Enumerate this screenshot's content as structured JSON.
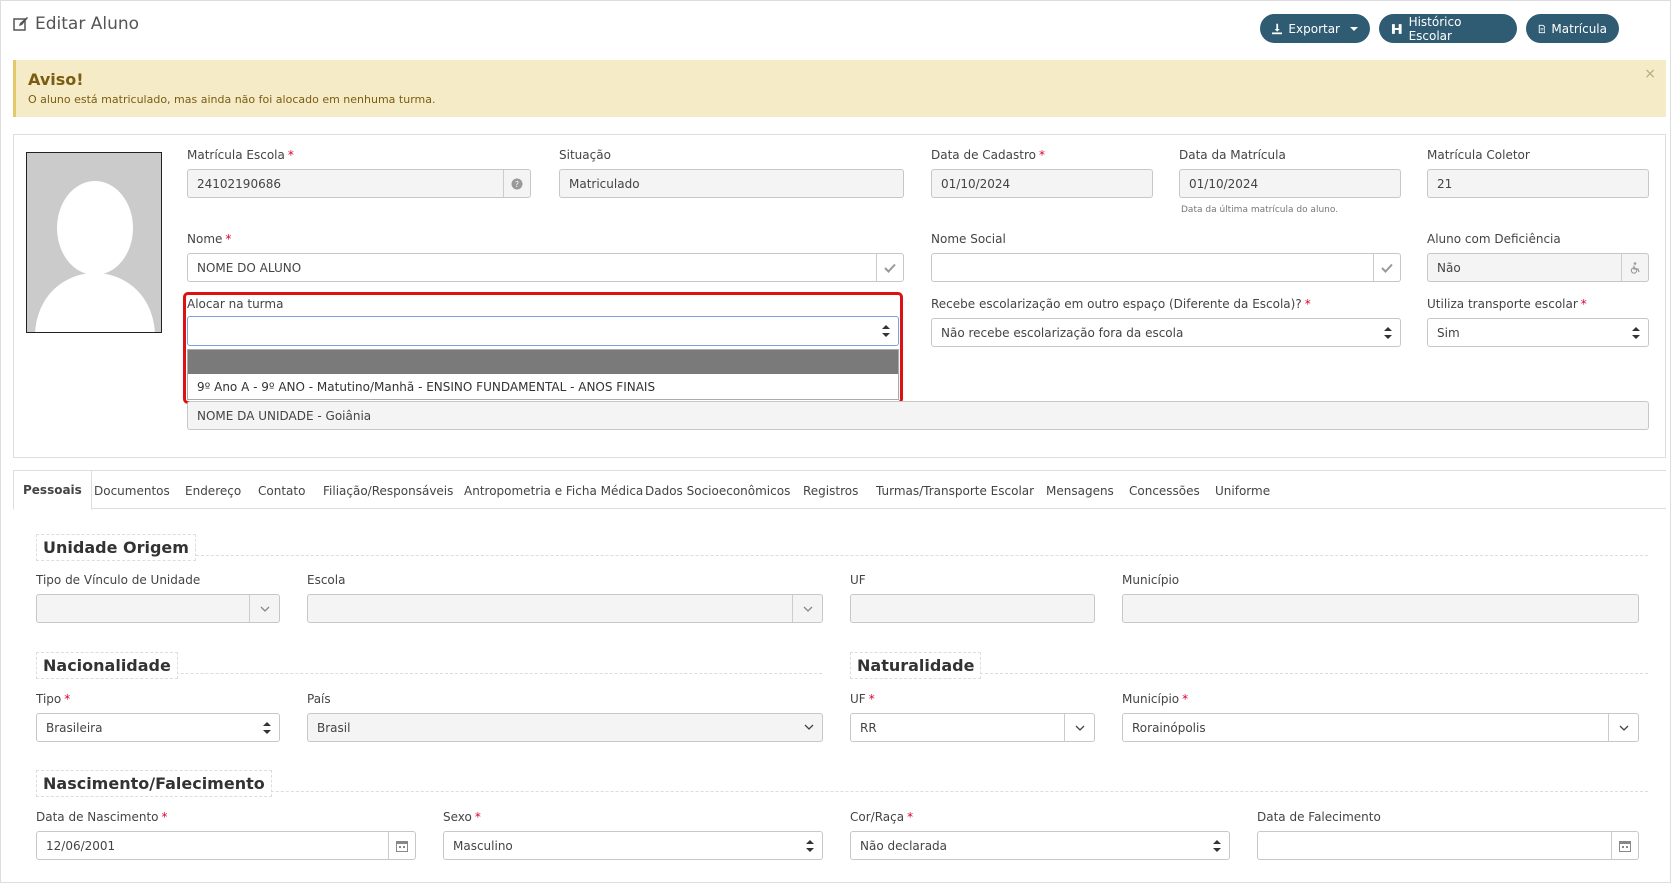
{
  "page": {
    "title": "Editar Aluno"
  },
  "actions": {
    "export": "Exportar",
    "history": "Histórico Escolar",
    "enrollment": "Matrícula"
  },
  "alert": {
    "title": "Aviso!",
    "text": "O aluno está matriculado, mas ainda não foi alocado em nenhuma turma.",
    "close": "×"
  },
  "student": {
    "matricula_escola": {
      "label": "Matrícula Escola",
      "value": "24102190686"
    },
    "situacao": {
      "label": "Situação",
      "value": "Matriculado"
    },
    "data_cadastro": {
      "label": "Data de Cadastro",
      "value": "01/10/2024"
    },
    "data_matricula": {
      "label": "Data da Matrícula",
      "value": "01/10/2024",
      "help": "Data da última matrícula do aluno."
    },
    "matricula_coletor": {
      "label": "Matrícula Coletor",
      "value": "21"
    },
    "nome": {
      "label": "Nome",
      "value": "NOME DO ALUNO"
    },
    "nome_social": {
      "label": "Nome Social",
      "value": ""
    },
    "deficiencia": {
      "label": "Aluno com Deficiência",
      "value": "Não"
    },
    "turma": {
      "label": "Alocar na turma",
      "value": "",
      "options": [
        "",
        "9º Ano A - 9º ANO - Matutino/Manhã - ENSINO FUNDAMENTAL - ANOS FINAIS"
      ]
    },
    "escolarizacao": {
      "label": "Recebe escolarização em outro espaço (Diferente da Escola)?",
      "value": "Não recebe escolarização fora da escola"
    },
    "transporte": {
      "label": "Utiliza transporte escolar",
      "value": "Sim"
    },
    "unidade": {
      "value": "NOME DA UNIDADE - Goiânia"
    }
  },
  "tabs": [
    "Pessoais",
    "Documentos",
    "Endereço",
    "Contato",
    "Filiação/Responsáveis",
    "Antropometria e Ficha Médica",
    "Dados Socioeconômicos",
    "Registros",
    "Turmas/Transporte Escolar",
    "Mensagens",
    "Concessões",
    "Uniforme"
  ],
  "unidade_origem": {
    "legend": "Unidade Origem",
    "tipo_vinculo": {
      "label": "Tipo de Vínculo de Unidade",
      "value": ""
    },
    "escola": {
      "label": "Escola",
      "value": ""
    },
    "uf": {
      "label": "UF",
      "value": ""
    },
    "municipio": {
      "label": "Município",
      "value": ""
    }
  },
  "nacionalidade": {
    "legend": "Nacionalidade",
    "tipo": {
      "label": "Tipo",
      "value": "Brasileira"
    },
    "pais": {
      "label": "País",
      "value": "Brasil"
    }
  },
  "naturalidade": {
    "legend": "Naturalidade",
    "uf": {
      "label": "UF",
      "value": "RR"
    },
    "municipio": {
      "label": "Município",
      "value": "Rorainópolis"
    }
  },
  "nascimento": {
    "legend": "Nascimento/Falecimento",
    "data_nascimento": {
      "label": "Data de Nascimento",
      "value": "12/06/2001"
    },
    "sexo": {
      "label": "Sexo",
      "value": "Masculino"
    },
    "cor_raca": {
      "label": "Cor/Raça",
      "value": "Não declarada"
    },
    "data_falecimento": {
      "label": "Data de Falecimento",
      "value": ""
    }
  },
  "colors": {
    "button": "#2f5b73",
    "alert_bg": "#f5ecc7",
    "highlight": "#dd1111"
  }
}
